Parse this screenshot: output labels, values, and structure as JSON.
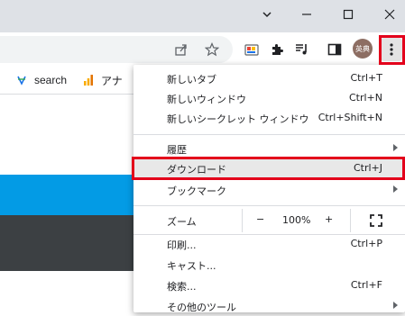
{
  "colors": {
    "accent_blue": "#039be5",
    "dark_band": "#3c4043",
    "highlight_red": "#e3001b",
    "avatar": "#8d6e63"
  },
  "bookmarks": {
    "items": [
      {
        "label": "search",
        "icon": "search-favicon-icon"
      },
      {
        "label": "アナ",
        "icon": "analytics-bars-icon"
      }
    ]
  },
  "profile": {
    "avatar_text": "英典"
  },
  "menu": {
    "new_tab": {
      "label": "新しいタブ",
      "shortcut": "Ctrl+T"
    },
    "new_window": {
      "label": "新しいウィンドウ",
      "shortcut": "Ctrl+N"
    },
    "new_incognito": {
      "label": "新しいシークレット ウィンドウ",
      "shortcut": "Ctrl+Shift+N"
    },
    "history": {
      "label": "履歴"
    },
    "downloads": {
      "label": "ダウンロード",
      "shortcut": "Ctrl+J"
    },
    "bookmarks": {
      "label": "ブックマーク"
    },
    "zoom": {
      "label": "ズーム",
      "minus": "−",
      "value": "100%",
      "plus": "+"
    },
    "print": {
      "label": "印刷...",
      "shortcut": "Ctrl+P"
    },
    "cast": {
      "label": "キャスト..."
    },
    "find": {
      "label": "検索...",
      "shortcut": "Ctrl+F"
    },
    "more_tools": {
      "label": "その他のツール"
    }
  }
}
